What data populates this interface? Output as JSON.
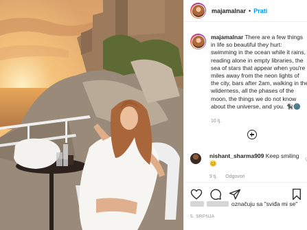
{
  "post": {
    "username": "majamalnar",
    "follow_label": "Prati",
    "separator": "•"
  },
  "caption": {
    "username": "majamalnar",
    "lines": [
      "There are a few things",
      "in life so beautiful they hurt:",
      "swimming in the ocean while it rains,",
      "reading alone in empty libraries, the",
      "sea of stars that appear when you're",
      "miles away from the neon lights of",
      "the city, bars after 2am, walking in the",
      "wilderness, all the phases of the",
      "moon, the things we do not know",
      "about the universe, and you. 🐈‍⬛🌚"
    ],
    "time": "10 tj."
  },
  "comment": {
    "username": "nishant_sharma909",
    "text": "Keep smiling",
    "emoji": "😊",
    "time": "9 tj.",
    "reply_label": "Odgovori"
  },
  "actions": {
    "like_icon": "heart-icon",
    "comment_icon": "comment-icon",
    "share_icon": "share-icon",
    "save_icon": "bookmark-icon"
  },
  "likes": {
    "text": "označuju sa \"sviđa mi se\""
  },
  "date": "5. SRPNJA"
}
